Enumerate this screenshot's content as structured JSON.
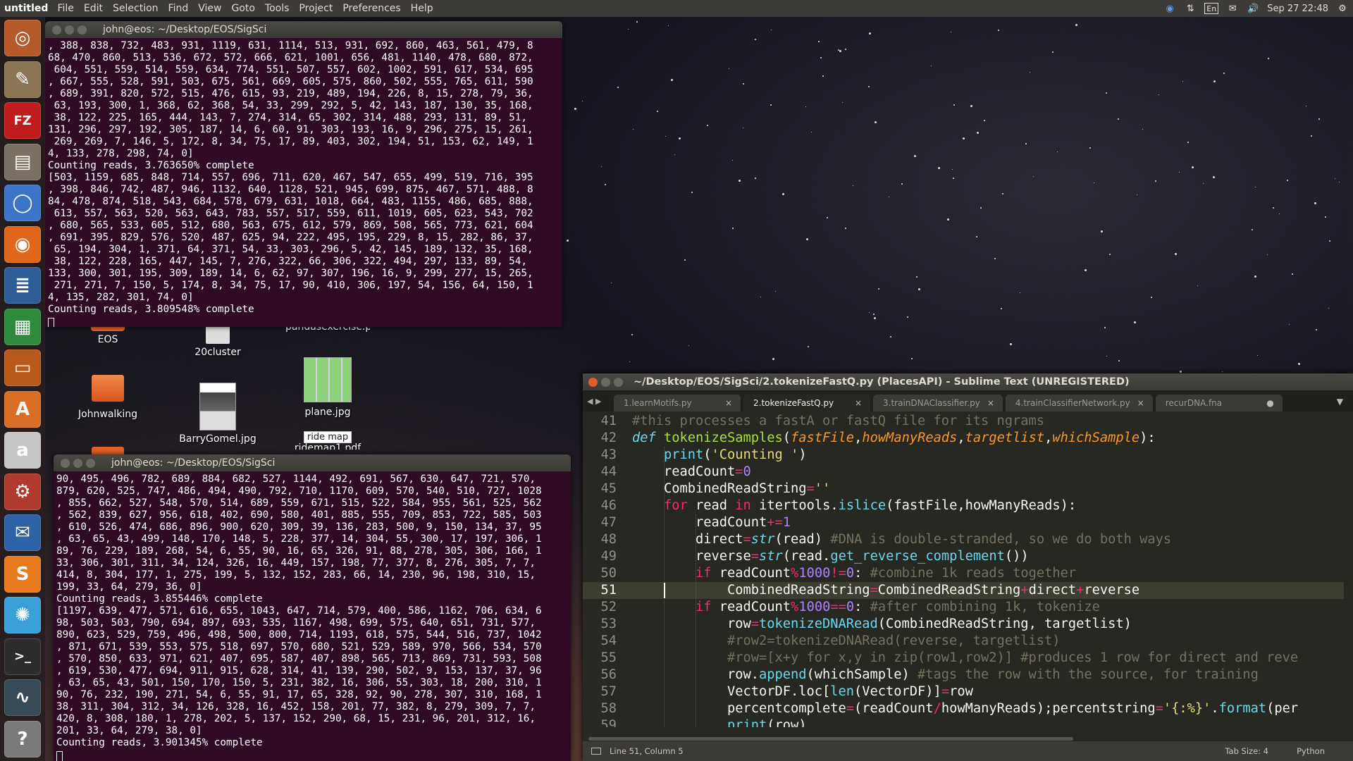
{
  "topbar": {
    "app": "untitled",
    "menus": [
      "File",
      "Edit",
      "Selection",
      "Find",
      "View",
      "Goto",
      "Tools",
      "Project",
      "Preferences",
      "Help"
    ],
    "lang": "En",
    "datetime": "Sep 27 22:48"
  },
  "launcher": [
    {
      "name": "ubuntu-dash-icon",
      "glyph": "◎",
      "color": "#b55a2a"
    },
    {
      "name": "gimp-icon",
      "glyph": "✎",
      "color": "#8a7654"
    },
    {
      "name": "filezilla-icon",
      "glyph": "FZ",
      "color": "#bf1d1d"
    },
    {
      "name": "file-manager-icon",
      "glyph": "▤",
      "color": "#7a7164"
    },
    {
      "name": "chromium-icon",
      "glyph": "◯",
      "color": "#3c74c8"
    },
    {
      "name": "firefox-icon",
      "glyph": "◉",
      "color": "#e0661b"
    },
    {
      "name": "writer-icon",
      "glyph": "≣",
      "color": "#2e5e97"
    },
    {
      "name": "calc-icon",
      "glyph": "▦",
      "color": "#2e8b3c"
    },
    {
      "name": "impress-icon",
      "glyph": "▭",
      "color": "#b8591c"
    },
    {
      "name": "software-center-icon",
      "glyph": "A",
      "color": "#d96d23"
    },
    {
      "name": "amazon-icon",
      "glyph": "a",
      "color": "#c6c6c6"
    },
    {
      "name": "system-settings-icon",
      "glyph": "⚙",
      "color": "#b03a2e"
    },
    {
      "name": "thunderbird-icon",
      "glyph": "✉",
      "color": "#2e63a8"
    },
    {
      "name": "sublime-text-icon",
      "glyph": "S",
      "color": "#e87a1e"
    },
    {
      "name": "remmina-icon",
      "glyph": "✺",
      "color": "#3aa0d8"
    },
    {
      "name": "terminal-icon",
      "glyph": ">_",
      "color": "#2c2c2c"
    },
    {
      "name": "system-monitor-icon",
      "glyph": "∿",
      "color": "#384a55"
    },
    {
      "name": "help-icon",
      "glyph": "?",
      "color": "#7a7a7a"
    },
    {
      "name": "trash-icon",
      "glyph": "▥",
      "color": "#6a6a6a"
    }
  ],
  "desktop": {
    "eos": "EOS",
    "cluster": "20cluster",
    "pandas": "pandasexercise.py",
    "johnwalking": "Johnwalking",
    "barry": "BarryGomel.jpg",
    "plane": "plane.jpg",
    "ridemap": "ride map",
    "ridemap2": "ridemap1.pdf"
  },
  "term1": {
    "title": "john@eos: ~/Desktop/EOS/SigSci",
    "lines": [
      ", 388, 838, 732, 483, 931, 1119, 631, 1114, 513, 931, 692, 860, 463, 561, 479, 8",
      "68, 470, 860, 513, 536, 672, 572, 666, 621, 1001, 656, 481, 1140, 478, 680, 872,",
      " 604, 551, 559, 514, 559, 634, 774, 551, 507, 557, 602, 1002, 591, 617, 534, 695",
      ", 667, 555, 528, 591, 503, 675, 561, 669, 605, 575, 860, 502, 555, 765, 611, 590",
      ", 689, 391, 820, 572, 515, 476, 615, 93, 219, 489, 194, 226, 8, 15, 278, 79, 36,",
      " 63, 193, 300, 1, 368, 62, 368, 54, 33, 299, 292, 5, 42, 143, 187, 130, 35, 168,",
      " 38, 122, 225, 165, 444, 143, 7, 274, 314, 65, 302, 314, 488, 293, 131, 89, 51,",
      "131, 296, 297, 192, 305, 187, 14, 6, 60, 91, 303, 193, 16, 9, 296, 275, 15, 261,",
      " 269, 269, 7, 146, 5, 172, 8, 34, 75, 17, 89, 403, 302, 194, 51, 153, 62, 149, 1",
      "4, 133, 278, 298, 74, 0]",
      "Counting reads, 3.763650% complete",
      "[503, 1159, 685, 848, 714, 557, 696, 711, 620, 467, 547, 655, 499, 519, 716, 395",
      ", 398, 846, 742, 487, 946, 1132, 640, 1128, 521, 945, 699, 875, 467, 571, 488, 8",
      "84, 478, 874, 518, 543, 684, 578, 679, 631, 1018, 664, 483, 1155, 486, 685, 888,",
      " 613, 557, 563, 520, 563, 643, 783, 557, 517, 559, 611, 1019, 605, 623, 543, 702",
      ", 680, 565, 533, 605, 512, 680, 563, 675, 612, 579, 869, 508, 565, 773, 621, 604",
      ", 691, 395, 829, 576, 520, 487, 625, 94, 222, 495, 195, 229, 8, 15, 282, 86, 37,",
      " 65, 194, 304, 1, 371, 64, 371, 54, 33, 303, 296, 5, 42, 145, 189, 132, 35, 168,",
      " 38, 122, 228, 165, 447, 145, 7, 276, 322, 66, 306, 322, 494, 297, 133, 89, 54,",
      "133, 300, 301, 195, 309, 189, 14, 6, 62, 97, 307, 196, 16, 9, 299, 277, 15, 265,",
      " 271, 271, 7, 150, 5, 174, 8, 34, 75, 17, 90, 410, 306, 197, 54, 156, 64, 150, 1",
      "4, 135, 282, 301, 74, 0]",
      "Counting reads, 3.809548% complete"
    ]
  },
  "term2": {
    "title": "john@eos: ~/Desktop/EOS/SigSci",
    "lines": [
      "90, 495, 496, 782, 689, 884, 682, 527, 1144, 492, 691, 567, 630, 647, 721, 570,",
      "879, 620, 525, 747, 486, 494, 490, 792, 710, 1170, 609, 570, 540, 510, 727, 1028",
      ", 855, 662, 527, 548, 570, 514, 689, 559, 671, 515, 522, 584, 955, 561, 525, 562",
      ", 562, 839, 627, 956, 618, 402, 690, 580, 401, 885, 555, 709, 853, 722, 585, 503",
      ", 610, 526, 474, 686, 896, 900, 620, 309, 39, 136, 283, 500, 9, 150, 134, 37, 95",
      ", 63, 65, 43, 499, 148, 170, 148, 5, 228, 377, 14, 304, 55, 300, 17, 197, 306, 1",
      "89, 76, 229, 189, 268, 54, 6, 55, 90, 16, 65, 326, 91, 88, 278, 305, 306, 166, 1",
      "33, 306, 301, 311, 34, 124, 326, 16, 449, 157, 198, 77, 377, 8, 276, 305, 7, 7,",
      "414, 8, 304, 177, 1, 275, 199, 5, 132, 152, 283, 66, 14, 230, 96, 198, 310, 15,",
      "199, 33, 64, 279, 36, 0]",
      "Counting reads, 3.855446% complete",
      "[1197, 639, 477, 571, 616, 655, 1043, 647, 714, 579, 400, 586, 1162, 706, 634, 6",
      "98, 503, 503, 790, 694, 897, 693, 535, 1167, 498, 699, 575, 640, 651, 731, 577,",
      "890, 623, 529, 759, 496, 498, 500, 800, 714, 1193, 618, 575, 544, 516, 737, 1042",
      ", 871, 671, 539, 553, 575, 518, 697, 570, 680, 521, 529, 589, 970, 566, 534, 570",
      ", 570, 850, 633, 971, 621, 407, 695, 587, 407, 898, 565, 713, 869, 731, 593, 508",
      ", 619, 530, 477, 694, 911, 915, 628, 314, 41, 139, 290, 502, 9, 153, 137, 37, 96",
      ", 63, 65, 43, 501, 150, 170, 150, 5, 231, 382, 16, 306, 55, 303, 18, 200, 310, 1",
      "90, 76, 232, 190, 271, 54, 6, 55, 91, 17, 65, 328, 92, 90, 278, 307, 310, 168, 1",
      "38, 311, 304, 312, 34, 126, 328, 16, 452, 158, 201, 77, 382, 8, 279, 309, 7, 7,",
      "420, 8, 308, 180, 1, 278, 202, 5, 137, 152, 290, 68, 15, 231, 96, 201, 312, 16,",
      "201, 33, 64, 279, 38, 0]",
      "Counting reads, 3.901345% complete"
    ]
  },
  "sublime": {
    "title": "~/Desktop/EOS/SigSci/2.tokenizeFastQ.py (PlacesAPI) - Sublime Text (UNREGISTERED)",
    "tabs": [
      "1.learnMotifs.py",
      "2.tokenizeFastQ.py",
      "3.trainDNAClassifier.py",
      "4.trainClassifierNetwork.py",
      "recurDNA.fna"
    ],
    "status": {
      "pos": "Line 51, Column 5",
      "tabsize": "Tab Size: 4",
      "syntax": "Python"
    },
    "line_numbers": [
      "41",
      "42",
      "43",
      "44",
      "45",
      "46",
      "47",
      "48",
      "49",
      "50",
      "51",
      "52",
      "53",
      "54",
      "55",
      "56",
      "57",
      "58",
      "59"
    ],
    "code": [
      [
        [
          "c",
          "#this processes a fastA or fastQ file for its ngrams"
        ]
      ],
      [
        [
          "d",
          "def "
        ],
        [
          "f",
          "tokenizeSamples"
        ],
        [
          "",
          "("
        ],
        [
          "p",
          "fastFile"
        ],
        [
          "",
          ","
        ],
        [
          "p",
          "howManyReads"
        ],
        [
          "",
          ","
        ],
        [
          "p",
          "targetlist"
        ],
        [
          "",
          ","
        ],
        [
          "p",
          "whichSample"
        ],
        [
          "",
          "):"
        ]
      ],
      [
        [
          "",
          "    "
        ],
        [
          "b",
          "print"
        ],
        [
          "",
          "("
        ],
        [
          "s",
          "'Counting '"
        ],
        [
          "",
          ")"
        ]
      ],
      [
        [
          "",
          "    readCount"
        ],
        [
          "k",
          "="
        ],
        [
          "n",
          "0"
        ]
      ],
      [
        [
          "",
          "    CombinedReadString"
        ],
        [
          "k",
          "="
        ],
        [
          "s",
          "''"
        ]
      ],
      [
        [
          "",
          "    "
        ],
        [
          "k",
          "for"
        ],
        [
          "",
          " read "
        ],
        [
          "k",
          "in"
        ],
        [
          "",
          " itertools."
        ],
        [
          "b",
          "islice"
        ],
        [
          "",
          "(fastFile,howManyReads):"
        ]
      ],
      [
        [
          "",
          "        readCount"
        ],
        [
          "k",
          "+="
        ],
        [
          "n",
          "1"
        ]
      ],
      [
        [
          "",
          "        direct"
        ],
        [
          "k",
          "="
        ],
        [
          "st",
          "str"
        ],
        [
          "",
          "(read) "
        ],
        [
          "c",
          "#DNA is double-stranded, so we do both ways"
        ]
      ],
      [
        [
          "",
          "        reverse"
        ],
        [
          "k",
          "="
        ],
        [
          "st",
          "str"
        ],
        [
          "",
          "(read."
        ],
        [
          "b",
          "get_reverse_complement"
        ],
        [
          "",
          "())"
        ]
      ],
      [
        [
          "",
          "        "
        ],
        [
          "k",
          "if"
        ],
        [
          "",
          " readCount"
        ],
        [
          "k",
          "%"
        ],
        [
          "n",
          "1000"
        ],
        [
          "k",
          "!="
        ],
        [
          "n",
          "0"
        ],
        [
          "",
          ": "
        ],
        [
          "c",
          "#combine 1k reads together"
        ]
      ],
      [
        [
          "",
          "            CombinedReadString"
        ],
        [
          "k",
          "="
        ],
        [
          "",
          "CombinedReadString"
        ],
        [
          "k",
          "+"
        ],
        [
          "",
          "direct"
        ],
        [
          "k",
          "+"
        ],
        [
          "",
          "reverse"
        ]
      ],
      [
        [
          "",
          "        "
        ],
        [
          "k",
          "if"
        ],
        [
          "",
          " readCount"
        ],
        [
          "k",
          "%"
        ],
        [
          "n",
          "1000"
        ],
        [
          "k",
          "=="
        ],
        [
          "n",
          "0"
        ],
        [
          "",
          ": "
        ],
        [
          "c",
          "#after combining 1k, tokenize"
        ]
      ],
      [
        [
          "",
          "            row"
        ],
        [
          "k",
          "="
        ],
        [
          "b",
          "tokenizeDNARead"
        ],
        [
          "",
          "(CombinedReadString, targetlist)"
        ]
      ],
      [
        [
          "",
          "            "
        ],
        [
          "c",
          "#row2=tokenizeDNARead(reverse, targetlist)"
        ]
      ],
      [
        [
          "",
          "            "
        ],
        [
          "c",
          "#row=[x+y for x,y in zip(row1,row2)] #produces 1 row for direct and reve"
        ]
      ],
      [
        [
          "",
          "            row."
        ],
        [
          "b",
          "append"
        ],
        [
          "",
          "(whichSample) "
        ],
        [
          "c",
          "#tags the row with the source, for training"
        ]
      ],
      [
        [
          "",
          "            VectorDF.loc["
        ],
        [
          "b",
          "len"
        ],
        [
          "",
          "(VectorDF)]"
        ],
        [
          "k",
          "="
        ],
        [
          "",
          "row"
        ]
      ],
      [
        [
          "",
          "            percentcomplete"
        ],
        [
          "k",
          "="
        ],
        [
          "",
          "(readCount"
        ],
        [
          "k",
          "/"
        ],
        [
          "",
          "howManyReads);percentstring"
        ],
        [
          "k",
          "="
        ],
        [
          "s",
          "'{:%}'"
        ],
        [
          "",
          "."
        ],
        [
          "b",
          "format"
        ],
        [
          "",
          "(per"
        ]
      ],
      [
        [
          "",
          "            "
        ],
        [
          "b",
          "print"
        ],
        [
          "",
          "(row)"
        ]
      ]
    ]
  }
}
